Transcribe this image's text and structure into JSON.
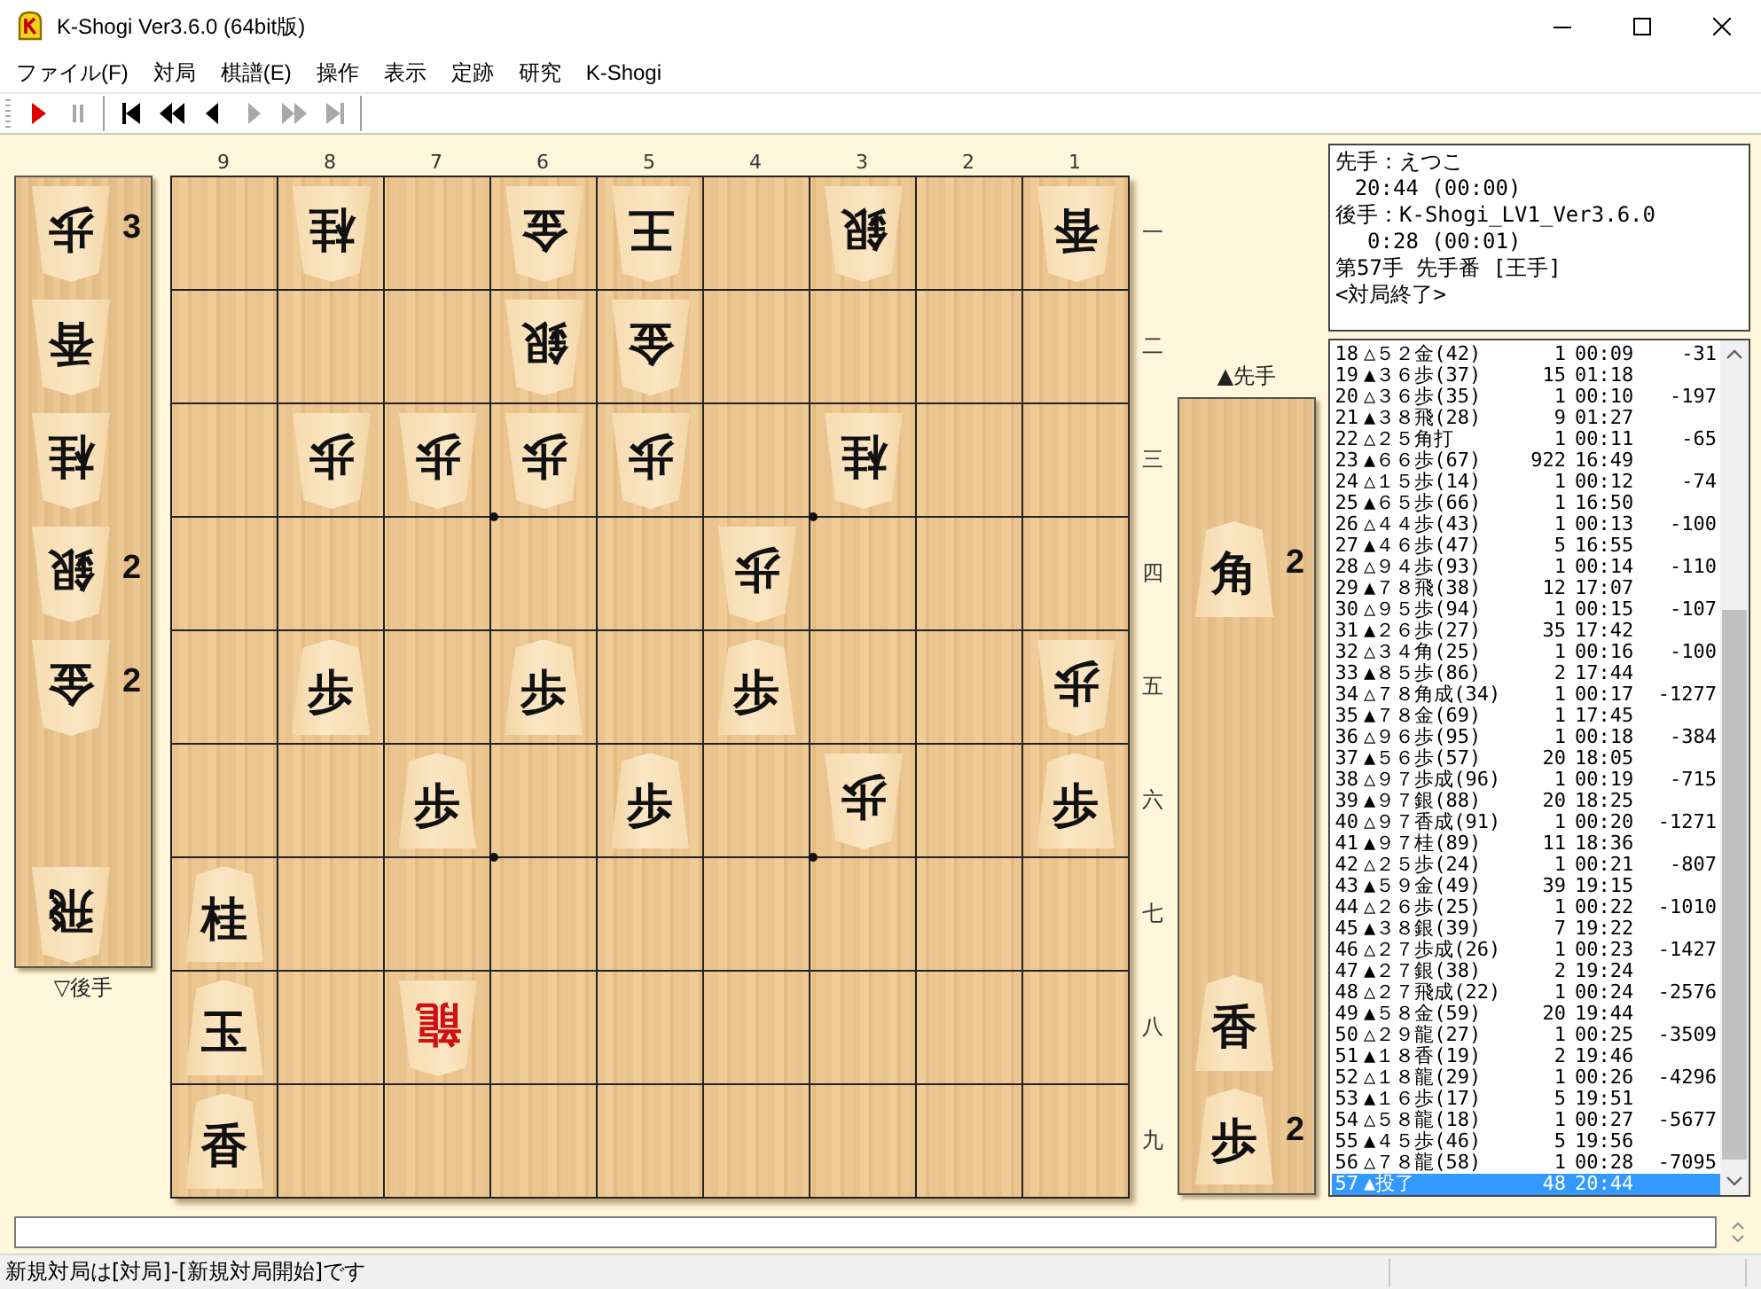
{
  "window": {
    "title": "K-Shogi Ver3.6.0 (64bit版)",
    "controls": [
      {
        "kind": "minimize"
      },
      {
        "kind": "maximize"
      },
      {
        "kind": "close"
      }
    ]
  },
  "menu": [
    "ファイル(F)",
    "対局",
    "棋譜(E)",
    "操作",
    "表示",
    "定跡",
    "研究",
    "K-Shogi"
  ],
  "toolbar": [
    {
      "kind": "play",
      "disabled": false
    },
    {
      "kind": "pause",
      "disabled": true
    },
    {
      "kind": "first",
      "disabled": false
    },
    {
      "kind": "back-fast",
      "disabled": false
    },
    {
      "kind": "back",
      "disabled": false
    },
    {
      "kind": "forward",
      "disabled": true
    },
    {
      "kind": "forward-fast",
      "disabled": true
    },
    {
      "kind": "last",
      "disabled": true
    }
  ],
  "gote_hand": {
    "label": "▽後手",
    "slots": [
      {
        "kind": "piece",
        "text": "歩",
        "count": "3"
      },
      {
        "kind": "piece",
        "text": "香"
      },
      {
        "kind": "piece",
        "text": "桂"
      },
      {
        "kind": "piece",
        "text": "銀",
        "count": "2"
      },
      {
        "kind": "piece",
        "text": "金",
        "count": "2"
      },
      {
        "kind": "empty"
      },
      {
        "kind": "piece",
        "text": "飛"
      }
    ]
  },
  "board": {
    "file_labels": [
      "9",
      "8",
      "7",
      "6",
      "5",
      "4",
      "3",
      "2",
      "1"
    ],
    "rank_labels": [
      "一",
      "二",
      "三",
      "四",
      "五",
      "六",
      "七",
      "八",
      "九"
    ],
    "rows": [
      {
        "cells": [
          {
            "kind": "empty"
          },
          {
            "kind": "piece",
            "text": "桂",
            "gote": true,
            "promoted": false
          },
          {
            "kind": "empty"
          },
          {
            "kind": "piece",
            "text": "金",
            "gote": true,
            "promoted": false
          },
          {
            "kind": "piece",
            "text": "王",
            "gote": true,
            "promoted": false
          },
          {
            "kind": "empty"
          },
          {
            "kind": "piece",
            "text": "銀",
            "gote": true,
            "promoted": false
          },
          {
            "kind": "empty"
          },
          {
            "kind": "piece",
            "text": "香",
            "gote": true,
            "promoted": false
          }
        ]
      },
      {
        "cells": [
          {
            "kind": "empty"
          },
          {
            "kind": "empty"
          },
          {
            "kind": "empty"
          },
          {
            "kind": "piece",
            "text": "銀",
            "gote": true,
            "promoted": false
          },
          {
            "kind": "piece",
            "text": "金",
            "gote": true,
            "promoted": false
          },
          {
            "kind": "empty"
          },
          {
            "kind": "empty"
          },
          {
            "kind": "empty"
          },
          {
            "kind": "empty"
          }
        ]
      },
      {
        "cells": [
          {
            "kind": "empty"
          },
          {
            "kind": "piece",
            "text": "歩",
            "gote": true,
            "promoted": false
          },
          {
            "kind": "piece",
            "text": "歩",
            "gote": true,
            "promoted": false
          },
          {
            "kind": "piece",
            "text": "歩",
            "gote": true,
            "promoted": false
          },
          {
            "kind": "piece",
            "text": "歩",
            "gote": true,
            "promoted": false
          },
          {
            "kind": "empty"
          },
          {
            "kind": "piece",
            "text": "桂",
            "gote": true,
            "promoted": false
          },
          {
            "kind": "empty"
          },
          {
            "kind": "empty"
          }
        ]
      },
      {
        "cells": [
          {
            "kind": "empty"
          },
          {
            "kind": "empty"
          },
          {
            "kind": "empty"
          },
          {
            "kind": "empty"
          },
          {
            "kind": "empty"
          },
          {
            "kind": "piece",
            "text": "歩",
            "gote": true,
            "promoted": false
          },
          {
            "kind": "empty"
          },
          {
            "kind": "empty"
          },
          {
            "kind": "empty"
          }
        ]
      },
      {
        "cells": [
          {
            "kind": "empty"
          },
          {
            "kind": "piece",
            "text": "歩",
            "gote": false,
            "promoted": false
          },
          {
            "kind": "empty"
          },
          {
            "kind": "piece",
            "text": "歩",
            "gote": false,
            "promoted": false
          },
          {
            "kind": "empty"
          },
          {
            "kind": "piece",
            "text": "歩",
            "gote": false,
            "promoted": false
          },
          {
            "kind": "empty"
          },
          {
            "kind": "empty"
          },
          {
            "kind": "piece",
            "text": "歩",
            "gote": true,
            "promoted": false
          }
        ]
      },
      {
        "cells": [
          {
            "kind": "empty"
          },
          {
            "kind": "empty"
          },
          {
            "kind": "piece",
            "text": "歩",
            "gote": false,
            "promoted": false
          },
          {
            "kind": "empty"
          },
          {
            "kind": "piece",
            "text": "歩",
            "gote": false,
            "promoted": false
          },
          {
            "kind": "empty"
          },
          {
            "kind": "piece",
            "text": "歩",
            "gote": true,
            "promoted": false
          },
          {
            "kind": "empty"
          },
          {
            "kind": "piece",
            "text": "歩",
            "gote": false,
            "promoted": false
          }
        ]
      },
      {
        "cells": [
          {
            "kind": "piece",
            "text": "桂",
            "gote": false,
            "promoted": false
          },
          {
            "kind": "empty"
          },
          {
            "kind": "empty"
          },
          {
            "kind": "empty"
          },
          {
            "kind": "empty"
          },
          {
            "kind": "empty"
          },
          {
            "kind": "empty"
          },
          {
            "kind": "empty"
          },
          {
            "kind": "empty"
          }
        ]
      },
      {
        "cells": [
          {
            "kind": "piece",
            "text": "玉",
            "gote": false,
            "promoted": false
          },
          {
            "kind": "empty"
          },
          {
            "kind": "piece",
            "text": "龍",
            "gote": true,
            "promoted": true
          },
          {
            "kind": "empty"
          },
          {
            "kind": "empty"
          },
          {
            "kind": "empty"
          },
          {
            "kind": "empty"
          },
          {
            "kind": "empty"
          },
          {
            "kind": "empty"
          }
        ]
      },
      {
        "cells": [
          {
            "kind": "piece",
            "text": "香",
            "gote": false,
            "promoted": false
          },
          {
            "kind": "empty"
          },
          {
            "kind": "empty"
          },
          {
            "kind": "empty"
          },
          {
            "kind": "empty"
          },
          {
            "kind": "empty"
          },
          {
            "kind": "empty"
          },
          {
            "kind": "empty"
          },
          {
            "kind": "empty"
          }
        ]
      }
    ]
  },
  "sente_hand": {
    "label": "▲先手",
    "slots": [
      {
        "kind": "empty"
      },
      {
        "kind": "piece",
        "text": "角",
        "count": "2"
      },
      {
        "kind": "empty"
      },
      {
        "kind": "empty"
      },
      {
        "kind": "empty"
      },
      {
        "kind": "piece",
        "text": "香"
      },
      {
        "kind": "piece",
        "text": "歩",
        "count": "2"
      }
    ]
  },
  "info": [
    {
      "kind": "line",
      "text": "先手：えつこ"
    },
    {
      "kind": "time",
      "text": "20:44 (00:00)"
    },
    {
      "kind": "line",
      "text": "後手：K-Shogi_LV1_Ver3.6.0"
    },
    {
      "kind": "time",
      "text": "0:28 (00:01)"
    },
    {
      "kind": "line",
      "text": "第57手 先手番 [王手]"
    },
    {
      "kind": "line",
      "text": "<対局終了>"
    }
  ],
  "moves": [
    {
      "number": "18",
      "move": "△５２金(42)",
      "used": "1",
      "total": "00:09",
      "eval": "-31",
      "selected": false
    },
    {
      "number": "19",
      "move": "▲３６歩(37)",
      "used": "15",
      "total": "01:18",
      "selected": false
    },
    {
      "number": "20",
      "move": "△３６歩(35)",
      "used": "1",
      "total": "00:10",
      "eval": "-197",
      "selected": false
    },
    {
      "number": "21",
      "move": "▲３８飛(28)",
      "used": "9",
      "total": "01:27",
      "selected": false
    },
    {
      "number": "22",
      "move": "△２５角打",
      "used": "1",
      "total": "00:11",
      "eval": "-65",
      "selected": false
    },
    {
      "number": "23",
      "move": "▲６６歩(67)",
      "used": "922",
      "total": "16:49",
      "selected": false
    },
    {
      "number": "24",
      "move": "△１５歩(14)",
      "used": "1",
      "total": "00:12",
      "eval": "-74",
      "selected": false
    },
    {
      "number": "25",
      "move": "▲６５歩(66)",
      "used": "1",
      "total": "16:50",
      "selected": false
    },
    {
      "number": "26",
      "move": "△４４歩(43)",
      "used": "1",
      "total": "00:13",
      "eval": "-100",
      "selected": false
    },
    {
      "number": "27",
      "move": "▲４６歩(47)",
      "used": "5",
      "total": "16:55",
      "selected": false
    },
    {
      "number": "28",
      "move": "△９４歩(93)",
      "used": "1",
      "total": "00:14",
      "eval": "-110",
      "selected": false
    },
    {
      "number": "29",
      "move": "▲７８飛(38)",
      "used": "12",
      "total": "17:07",
      "selected": false
    },
    {
      "number": "30",
      "move": "△９５歩(94)",
      "used": "1",
      "total": "00:15",
      "eval": "-107",
      "selected": false
    },
    {
      "number": "31",
      "move": "▲２６歩(27)",
      "used": "35",
      "total": "17:42",
      "selected": false
    },
    {
      "number": "32",
      "move": "△３４角(25)",
      "used": "1",
      "total": "00:16",
      "eval": "-100",
      "selected": false
    },
    {
      "number": "33",
      "move": "▲８５歩(86)",
      "used": "2",
      "total": "17:44",
      "selected": false
    },
    {
      "number": "34",
      "move": "△７８角成(34)",
      "used": "1",
      "total": "00:17",
      "eval": "-1277",
      "selected": false
    },
    {
      "number": "35",
      "move": "▲７８金(69)",
      "used": "1",
      "total": "17:45",
      "selected": false
    },
    {
      "number": "36",
      "move": "△９６歩(95)",
      "used": "1",
      "total": "00:18",
      "eval": "-384",
      "selected": false
    },
    {
      "number": "37",
      "move": "▲５６歩(57)",
      "used": "20",
      "total": "18:05",
      "selected": false
    },
    {
      "number": "38",
      "move": "△９７歩成(96)",
      "used": "1",
      "total": "00:19",
      "eval": "-715",
      "selected": false
    },
    {
      "number": "39",
      "move": "▲９７銀(88)",
      "used": "20",
      "total": "18:25",
      "selected": false
    },
    {
      "number": "40",
      "move": "△９７香成(91)",
      "used": "1",
      "total": "00:20",
      "eval": "-1271",
      "selected": false
    },
    {
      "number": "41",
      "move": "▲９７桂(89)",
      "used": "11",
      "total": "18:36",
      "selected": false
    },
    {
      "number": "42",
      "move": "△２５歩(24)",
      "used": "1",
      "total": "00:21",
      "eval": "-807",
      "selected": false
    },
    {
      "number": "43",
      "move": "▲５９金(49)",
      "used": "39",
      "total": "19:15",
      "selected": false
    },
    {
      "number": "44",
      "move": "△２６歩(25)",
      "used": "1",
      "total": "00:22",
      "eval": "-1010",
      "selected": false
    },
    {
      "number": "45",
      "move": "▲３８銀(39)",
      "used": "7",
      "total": "19:22",
      "selected": false
    },
    {
      "number": "46",
      "move": "△２７歩成(26)",
      "used": "1",
      "total": "00:23",
      "eval": "-1427",
      "selected": false
    },
    {
      "number": "47",
      "move": "▲２７銀(38)",
      "used": "2",
      "total": "19:24",
      "selected": false
    },
    {
      "number": "48",
      "move": "△２７飛成(22)",
      "used": "1",
      "total": "00:24",
      "eval": "-2576",
      "selected": false
    },
    {
      "number": "49",
      "move": "▲５８金(59)",
      "used": "20",
      "total": "19:44",
      "selected": false
    },
    {
      "number": "50",
      "move": "△２９龍(27)",
      "used": "1",
      "total": "00:25",
      "eval": "-3509",
      "selected": false
    },
    {
      "number": "51",
      "move": "▲１８香(19)",
      "used": "2",
      "total": "19:46",
      "selected": false
    },
    {
      "number": "52",
      "move": "△１８龍(29)",
      "used": "1",
      "total": "00:26",
      "eval": "-4296",
      "selected": false
    },
    {
      "number": "53",
      "move": "▲１６歩(17)",
      "used": "5",
      "total": "19:51",
      "selected": false
    },
    {
      "number": "54",
      "move": "△５８龍(18)",
      "used": "1",
      "total": "00:27",
      "eval": "-5677",
      "selected": false
    },
    {
      "number": "55",
      "move": "▲４５歩(46)",
      "used": "5",
      "total": "19:56",
      "selected": false
    },
    {
      "number": "56",
      "move": "△７８龍(58)",
      "used": "1",
      "total": "00:28",
      "eval": "-7095",
      "selected": false
    },
    {
      "number": "57",
      "move": "▲投了",
      "used": "48",
      "total": "20:44",
      "selected": true
    }
  ],
  "status_bar": {
    "text": "新規対局は[対局]-[新規対局開始]です"
  }
}
